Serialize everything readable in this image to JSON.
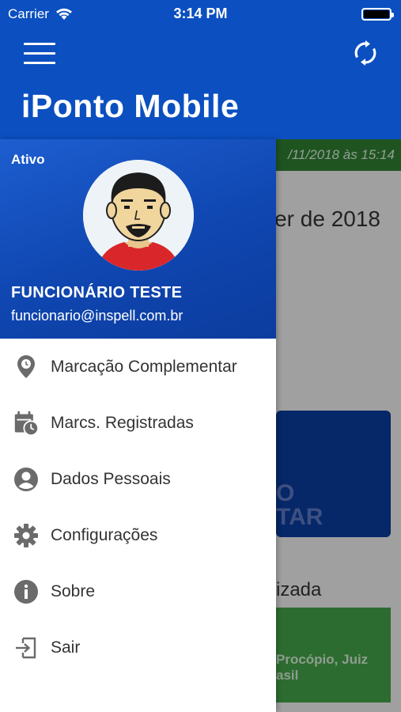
{
  "status_bar": {
    "carrier": "Carrier",
    "time": "3:14 PM"
  },
  "header": {
    "title": "iPonto Mobile"
  },
  "background": {
    "date_text": "/11/2018 às 15:14",
    "month_text": "er de 2018",
    "card_line1": "O",
    "card_line2": "TAR",
    "section_label": "izada",
    "green_text_line1": "Procópio, Juiz",
    "green_text_line2": "asil"
  },
  "drawer": {
    "status": "Ativo",
    "user_name": "FUNCIONÁRIO TESTE",
    "user_email": "funcionario@inspell.com.br",
    "items": [
      {
        "label": "Marcação Complementar",
        "icon": "location-pin-icon"
      },
      {
        "label": "Marcs. Registradas",
        "icon": "calendar-clock-icon"
      },
      {
        "label": "Dados Pessoais",
        "icon": "account-circle-icon"
      },
      {
        "label": "Configurações",
        "icon": "gear-icon"
      },
      {
        "label": "Sobre",
        "icon": "info-icon"
      },
      {
        "label": "Sair",
        "icon": "logout-icon"
      }
    ]
  },
  "colors": {
    "primary": "#0b4fc0",
    "green": "#2e7d32",
    "icon_gray": "#6b6b6b"
  }
}
